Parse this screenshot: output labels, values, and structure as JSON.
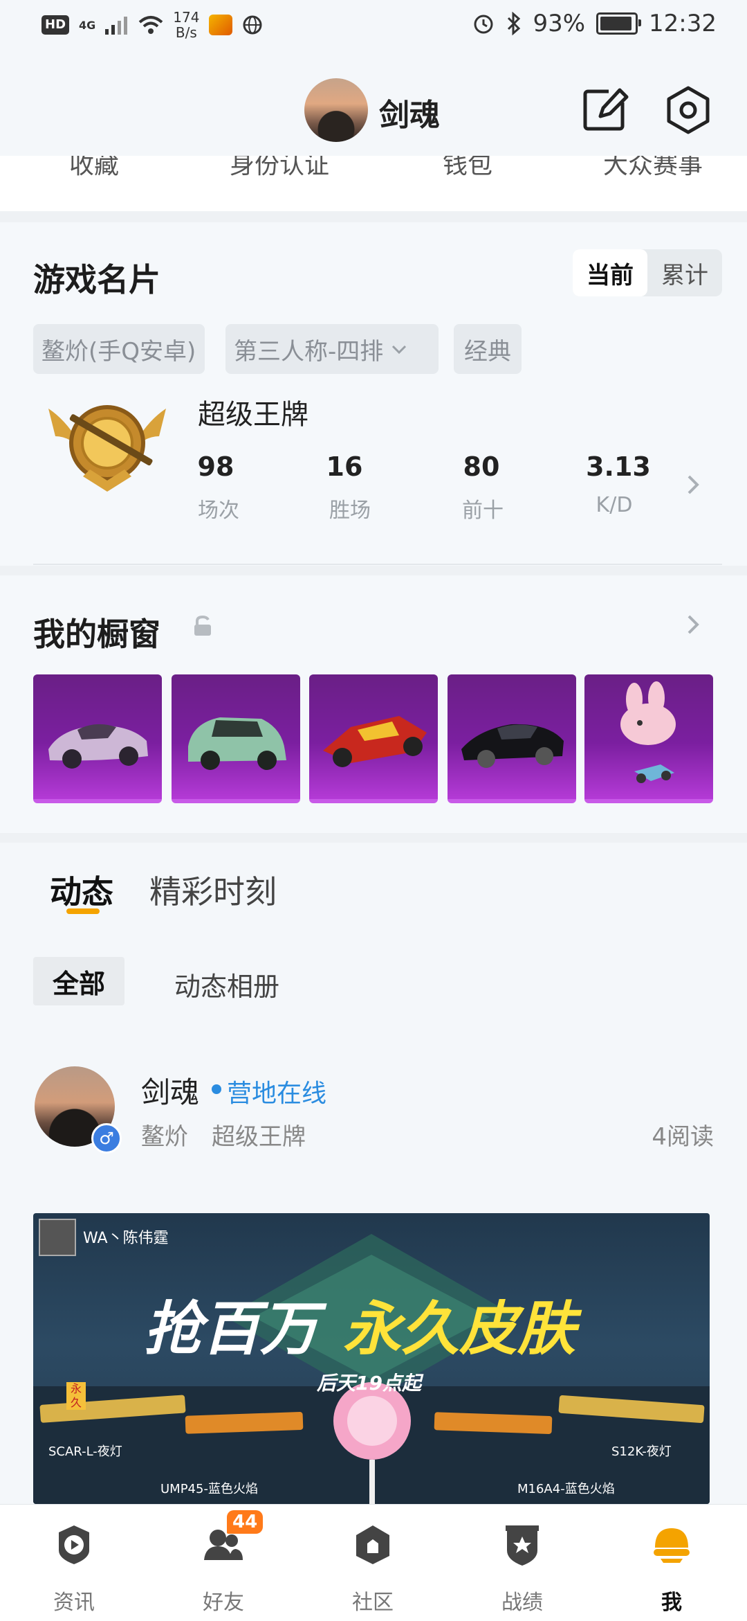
{
  "status_bar": {
    "hd": "HD",
    "network": "4G",
    "speed_value": "174",
    "speed_unit": "B/s",
    "battery_pct": "93%",
    "battery_level": 0.93,
    "time": "12:32"
  },
  "header": {
    "username": "剑魂",
    "edit_icon": "edit-icon",
    "settings_icon": "hexagon-settings-icon"
  },
  "quick_tabs": [
    "收藏",
    "身份认证",
    "钱包",
    "大众赛事"
  ],
  "game_card": {
    "title": "游戏名片",
    "toggle": [
      "当前",
      "累计"
    ],
    "filters": [
      "鳌炌(手Q安卓)",
      "第三人称-四排",
      "经典"
    ],
    "rank": "超级王牌",
    "stats": [
      {
        "value": "98",
        "label": "场次"
      },
      {
        "value": "16",
        "label": "胜场"
      },
      {
        "value": "80",
        "label": "前十"
      },
      {
        "value": "3.13",
        "label": "K/D"
      }
    ]
  },
  "showcase": {
    "title": "我的橱窗",
    "items": [
      "pink-sports-car",
      "green-suv",
      "red-racer",
      "black-sedan",
      "pink-rabbit-mount"
    ]
  },
  "feed": {
    "tabs": [
      "动态",
      "精彩时刻"
    ],
    "sub_tabs": [
      "全部",
      "动态相册"
    ],
    "post": {
      "name": "剑魂",
      "status": "营地在线",
      "server": "鳌炌",
      "rank": "超级王牌",
      "reads": "4阅读",
      "banner": {
        "author": "WA丶陈伟霆",
        "headline_white": "抢百万",
        "headline_yellow": "永久皮肤",
        "sub": "后天19点起",
        "guns": [
          "SCAR-L-夜灯",
          "UMP45-蓝色火焰",
          "M16A4-蓝色火焰",
          "S12K-夜灯"
        ],
        "tag": "永久"
      }
    }
  },
  "bottom_nav": [
    {
      "label": "资讯",
      "icon": "play-news-icon"
    },
    {
      "label": "好友",
      "icon": "friends-icon",
      "badge": "44"
    },
    {
      "label": "社区",
      "icon": "community-icon"
    },
    {
      "label": "战绩",
      "icon": "record-shield-icon"
    },
    {
      "label": "我",
      "icon": "helmet-me-icon",
      "active": true
    }
  ],
  "colors": {
    "accent": "#f4a300",
    "online": "#2a8ce0",
    "badge": "#ff7a1a",
    "showcase_bg": "#7b1fa0"
  }
}
